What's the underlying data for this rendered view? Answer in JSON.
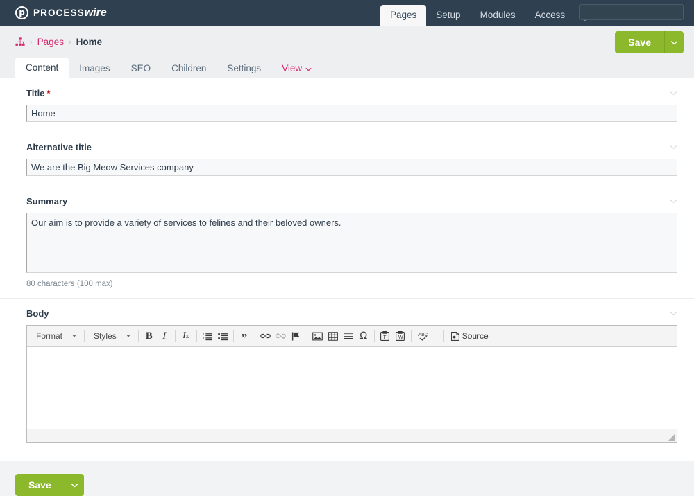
{
  "masthead": {
    "logo_mark": "p",
    "logo_text_a": "PROCESS",
    "logo_text_b": "wire",
    "logo_icon_name": "processwire-logo-icon",
    "nav": [
      {
        "label": "Pages",
        "active": true
      },
      {
        "label": "Setup",
        "active": false
      },
      {
        "label": "Modules",
        "active": false
      },
      {
        "label": "Access",
        "active": false
      }
    ],
    "tools_icon": "wrench-icon",
    "search": {
      "value": "",
      "placeholder": "",
      "icon": "search-icon"
    }
  },
  "breadcrumb": {
    "home_icon": "sitemap-icon",
    "separator": "›",
    "items": [
      {
        "label": "Pages",
        "current": false
      },
      {
        "label": "Home",
        "current": true
      }
    ]
  },
  "save_button": {
    "label": "Save",
    "dropdown_icon": "chevron-down-icon",
    "color": "#8cb82b"
  },
  "tabs": [
    {
      "label": "Content",
      "active": true
    },
    {
      "label": "Images",
      "active": false
    },
    {
      "label": "SEO",
      "active": false
    },
    {
      "label": "Children",
      "active": false
    },
    {
      "label": "Settings",
      "active": false
    },
    {
      "label": "View",
      "active": false,
      "style": "link",
      "icon": "chevron-down-icon"
    }
  ],
  "fields": {
    "title": {
      "label": "Title",
      "required_marker": "*",
      "value": "Home",
      "placeholder": "",
      "collapse_icon": "chevron-down-icon"
    },
    "alt_title": {
      "label": "Alternative title",
      "value": "We are the Big Meow Services company",
      "placeholder": "",
      "collapse_icon": "chevron-down-icon"
    },
    "summary": {
      "label": "Summary",
      "value": "Our aim is to provide a variety of services to felines and their beloved owners.",
      "placeholder": "",
      "note": "80 characters (100 max)",
      "collapse_icon": "chevron-down-icon"
    },
    "body": {
      "label": "Body",
      "value": "",
      "collapse_icon": "chevron-down-icon",
      "editor": {
        "format_label": "Format",
        "styles_label": "Styles",
        "source_label": "Source",
        "buttons": [
          {
            "name": "bold-icon",
            "glyph": "B",
            "disabled": false
          },
          {
            "name": "italic-icon",
            "glyph": "I",
            "disabled": false
          },
          {
            "name": "remove-format-icon",
            "glyph": "Ix",
            "disabled": false
          },
          {
            "name": "numbered-list-icon",
            "glyph": "",
            "disabled": false
          },
          {
            "name": "bulleted-list-icon",
            "glyph": "",
            "disabled": false
          },
          {
            "name": "blockquote-icon",
            "glyph": "”",
            "disabled": false
          },
          {
            "name": "link-icon",
            "glyph": "",
            "disabled": false
          },
          {
            "name": "unlink-icon",
            "glyph": "",
            "disabled": true
          },
          {
            "name": "anchor-icon",
            "glyph": "",
            "disabled": false
          },
          {
            "name": "image-icon",
            "glyph": "",
            "disabled": false
          },
          {
            "name": "table-icon",
            "glyph": "",
            "disabled": false
          },
          {
            "name": "horizontal-rule-icon",
            "glyph": "",
            "disabled": false
          },
          {
            "name": "special-character-icon",
            "glyph": "Ω",
            "disabled": false
          },
          {
            "name": "paste-as-text-icon",
            "glyph": "",
            "disabled": false
          },
          {
            "name": "paste-from-word-icon",
            "glyph": "",
            "disabled": false
          },
          {
            "name": "spell-check-icon",
            "glyph": "ABC",
            "disabled": false
          }
        ]
      }
    }
  },
  "footer": {
    "save_label": "Save",
    "dropdown_icon": "chevron-down-icon"
  }
}
